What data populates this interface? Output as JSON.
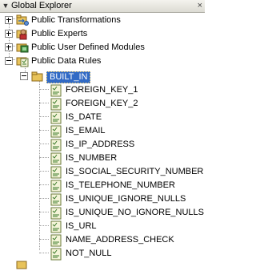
{
  "panel": {
    "title": "Global Explorer",
    "close_glyph": "×",
    "collapse_icon": "chevron-down-icon"
  },
  "tree": {
    "nodes": [
      {
        "label": "Public Transformations",
        "icon": "transformations-icon",
        "expanded": false
      },
      {
        "label": "Public Experts",
        "icon": "experts-icon",
        "expanded": false
      },
      {
        "label": "Public User Defined Modules",
        "icon": "user-module-icon",
        "expanded": false
      },
      {
        "label": "Public Data Rules",
        "icon": "data-rules-folder-icon",
        "expanded": true,
        "children": [
          {
            "label": "BUILT_IN",
            "icon": "folder-icon",
            "expanded": true,
            "selected": true,
            "children": [
              {
                "label": "FOREIGN_KEY_1",
                "icon": "data-rule-icon"
              },
              {
                "label": "FOREIGN_KEY_2",
                "icon": "data-rule-icon"
              },
              {
                "label": "IS_DATE",
                "icon": "data-rule-icon"
              },
              {
                "label": "IS_EMAIL",
                "icon": "data-rule-icon"
              },
              {
                "label": "IS_IP_ADDRESS",
                "icon": "data-rule-icon"
              },
              {
                "label": "IS_NUMBER",
                "icon": "data-rule-icon"
              },
              {
                "label": "IS_SOCIAL_SECURITY_NUMBER",
                "icon": "data-rule-icon"
              },
              {
                "label": "IS_TELEPHONE_NUMBER",
                "icon": "data-rule-icon"
              },
              {
                "label": "IS_UNIQUE_IGNORE_NULLS",
                "icon": "data-rule-icon"
              },
              {
                "label": "IS_UNIQUE_NO_IGNORE_NULLS",
                "icon": "data-rule-icon"
              },
              {
                "label": "IS_URL",
                "icon": "data-rule-icon"
              },
              {
                "label": "NAME_ADDRESS_CHECK",
                "icon": "data-rule-icon"
              },
              {
                "label": "NOT_NULL",
                "icon": "data-rule-icon"
              }
            ]
          }
        ]
      }
    ]
  }
}
